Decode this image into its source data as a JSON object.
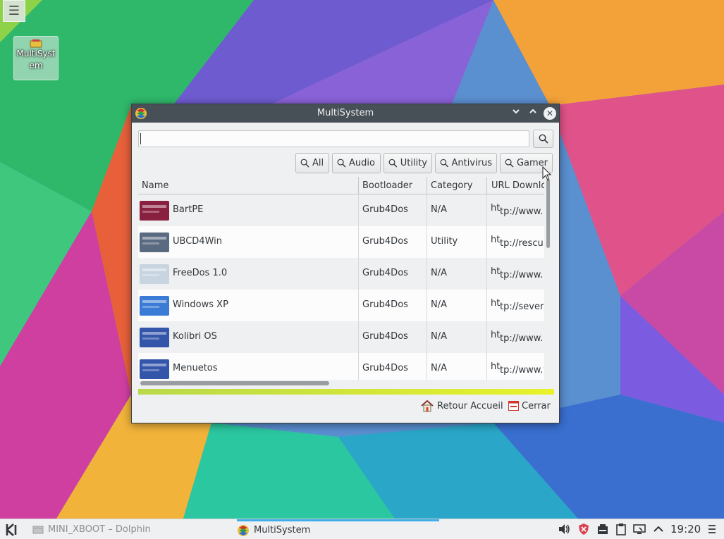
{
  "window": {
    "title": "MultiSystem",
    "app_icon": "multisystem-icon"
  },
  "desktop": {
    "icon_label": "MultiSystem",
    "menu_icon": "hamburger-icon"
  },
  "search": {
    "placeholder": "",
    "value": ""
  },
  "filters": [
    {
      "label": "All"
    },
    {
      "label": "Audio"
    },
    {
      "label": "Utility"
    },
    {
      "label": "Antivirus"
    },
    {
      "label": "Gamer"
    }
  ],
  "table": {
    "columns": [
      "Name",
      "Bootloader",
      "Category",
      "URL Downlo"
    ],
    "rows": [
      {
        "name": "BartPE",
        "bootloader": "Grub4Dos",
        "category": "N/A",
        "url_prefix": "ht",
        "url": "tp://www.h",
        "thumb_color": "#8a2040"
      },
      {
        "name": "UBCD4Win",
        "bootloader": "Grub4Dos",
        "category": "Utility",
        "url_prefix": "ht",
        "url": "tp://rescu",
        "thumb_color": "#5a6a80"
      },
      {
        "name": "FreeDos 1.0",
        "bootloader": "Grub4Dos",
        "category": "N/A",
        "url_prefix": "ht",
        "url": "tp://www.u",
        "thumb_color": "#c8d4e0"
      },
      {
        "name": "Windows XP",
        "bootloader": "Grub4Dos",
        "category": "N/A",
        "url_prefix": "ht",
        "url": "tp://severi",
        "thumb_color": "#3a7bd5"
      },
      {
        "name": "Kolibri OS",
        "bootloader": "Grub4Dos",
        "category": "N/A",
        "url_prefix": "ht",
        "url": "tp://www.u",
        "thumb_color": "#3355aa"
      },
      {
        "name": "Menuetos",
        "bootloader": "Grub4Dos",
        "category": "N/A",
        "url_prefix": "ht",
        "url": "tp://www.fr",
        "thumb_color": "#3355aa"
      }
    ]
  },
  "actions": {
    "home_label": "Retour Accueil",
    "close_label": "Cerrar"
  },
  "taskbar": {
    "tasks": [
      {
        "label": "MINI_XBOOT – Dolphin"
      },
      {
        "label": "MultiSystem"
      }
    ],
    "clock": "19:20"
  },
  "colors": {
    "accent": "#3daee9",
    "titlebar": "#475057",
    "progress_start": "#b8d94a",
    "progress_end": "#e8f22a"
  }
}
